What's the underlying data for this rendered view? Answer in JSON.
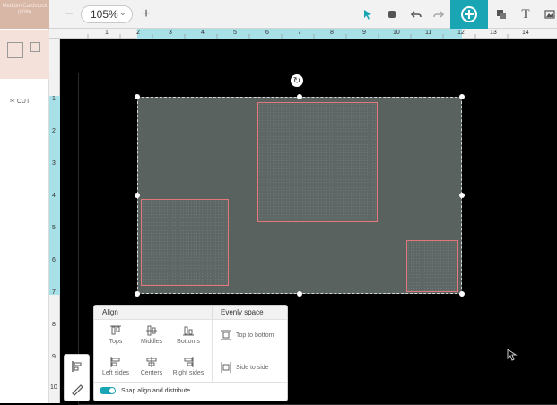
{
  "material": {
    "label": "Medium Cardstock (80lb)",
    "cut_label": "CUT",
    "accent": "#d9b7a7"
  },
  "toolbar": {
    "zoom_value": "105%",
    "icons": [
      "minus-icon",
      "plus-icon",
      "select-arrow-icon",
      "fill-bucket-icon",
      "undo-icon",
      "redo-icon",
      "add-plus-icon",
      "layers-icon",
      "text-icon",
      "image-icon"
    ],
    "accent": "#1aa5b4"
  },
  "ruler": {
    "top_numbers": [
      "1",
      "2",
      "3",
      "4",
      "5",
      "6",
      "7",
      "8",
      "9",
      "10",
      "11",
      "12",
      "13",
      "14"
    ],
    "left_numbers": [
      "1",
      "2",
      "3",
      "4",
      "5",
      "6",
      "7",
      "8",
      "9",
      "10"
    ]
  },
  "align_panel": {
    "align_title": "Align",
    "evenly_title": "Evenly space",
    "tops": "Tops",
    "middles": "Middles",
    "bottoms": "Bottoms",
    "left_sides": "Left sides",
    "centers": "Centers",
    "right_sides": "Right sides",
    "top_to_bottom": "Top to bottom",
    "side_to_side": "Side to side",
    "snap_label": "Snap align and distribute",
    "snap_on": true
  },
  "colors": {
    "selection_fill": "#5a6260",
    "shape_outline": "#e0787c"
  }
}
